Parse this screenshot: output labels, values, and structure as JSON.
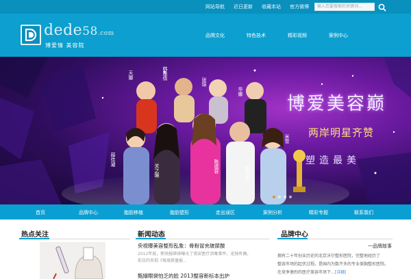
{
  "topbar": {
    "links": [
      "网站导航",
      "近日更新",
      "收藏本站",
      "官方微博"
    ],
    "search_placeholder": "输入您要搜索的关键词..."
  },
  "header": {
    "logo_text": "dede",
    "logo_num": "58",
    "logo_com": ".com",
    "logo_sub": "博爱情 美容院",
    "nav": [
      "品牌文化",
      "特色技术",
      "精彩视频",
      "案例中心"
    ]
  },
  "banner": {
    "names": [
      "天娜",
      "韩雅倩",
      "张琛",
      "华娜",
      "薛佳凝",
      "关之琳",
      "陈德容",
      "潘粤明",
      "米雪"
    ],
    "title": "博爱美容巅",
    "subtitle": "两岸明星齐赞",
    "tagline": "塑造最美",
    "slide_count": 4,
    "active_slide": 1
  },
  "main_nav": [
    "首页",
    "品牌中心",
    "脂肪移植",
    "脂肪塑形",
    "走出误区",
    "案例分析",
    "精彩专题",
    "联系我们"
  ],
  "content": {
    "hot": {
      "title": "热点关注"
    },
    "news": {
      "title": "新闻动态",
      "items": [
        {
          "headline": "央视曝美容整形乱象：骨粉冒充玻尿酸",
          "summary": [
            "2012年底，新快报继续曝光了南安医疗消毒事件。无独有偶，",
            "前日的央视《每周质量报..."
          ]
        },
        {
          "headline": "甄嬛眼袋怕乏的脸 2013整容新标本出炉",
          "summary": []
        }
      ]
    },
    "brand": {
      "title": "品牌中心",
      "story": "一品牌故事",
      "lines": [
        "拥有二十年创业历史的北京沃尔整形医院，完整地经历了",
        "整容市场的起伏过程。是国内为数不多的专业美胸整形医院。",
        "在竞争激烈的医疗美容市场下..."
      ],
      "more": "[详细]"
    }
  }
}
